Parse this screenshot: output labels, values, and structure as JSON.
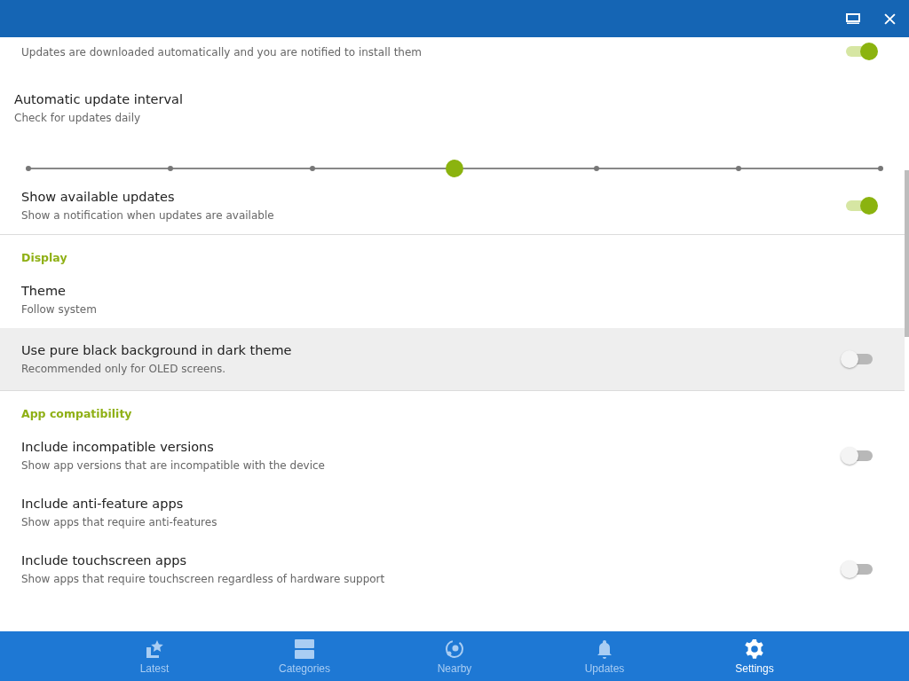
{
  "sections": [
    {
      "items": [
        {
          "kind": "toggle",
          "description": "Updates are downloaded automatically and you are notified to install them",
          "on": true,
          "highlighted": false
        },
        {
          "kind": "slider",
          "title": "Automatic update interval",
          "description": "Check for updates daily",
          "level": 0.5,
          "highlighted": false
        },
        {
          "kind": "toggle",
          "title": "Show available updates",
          "description": "Show a notification when updates are available",
          "on": true,
          "highlighted": false
        }
      ]
    },
    {
      "header": "Display",
      "items": [
        {
          "kind": "plain",
          "title": "Theme",
          "description": "Follow system",
          "highlighted": false
        },
        {
          "kind": "toggle",
          "title": "Use pure black background in dark theme",
          "description": "Recommended only for OLED screens.",
          "on": false,
          "highlighted": true
        }
      ]
    },
    {
      "header": "App compatibility",
      "items": [
        {
          "kind": "toggle",
          "title": "Include incompatible versions",
          "description": "Show app versions that are incompatible with the device",
          "on": false,
          "highlighted": false
        },
        {
          "kind": "plain",
          "title": "Include anti-feature apps",
          "description": "Show apps that require anti-features",
          "highlighted": false
        },
        {
          "kind": "toggle",
          "title": "Include touchscreen apps",
          "description": "Show apps that require touchscreen regardless of hardware support",
          "on": false,
          "highlighted": false
        }
      ]
    }
  ],
  "nav": [
    {
      "label": "Latest",
      "selected": false
    },
    {
      "label": "Categories",
      "selected": false
    },
    {
      "label": "Nearby",
      "selected": false
    },
    {
      "label": "Updates",
      "selected": false
    },
    {
      "label": "Settings",
      "selected": true
    }
  ]
}
